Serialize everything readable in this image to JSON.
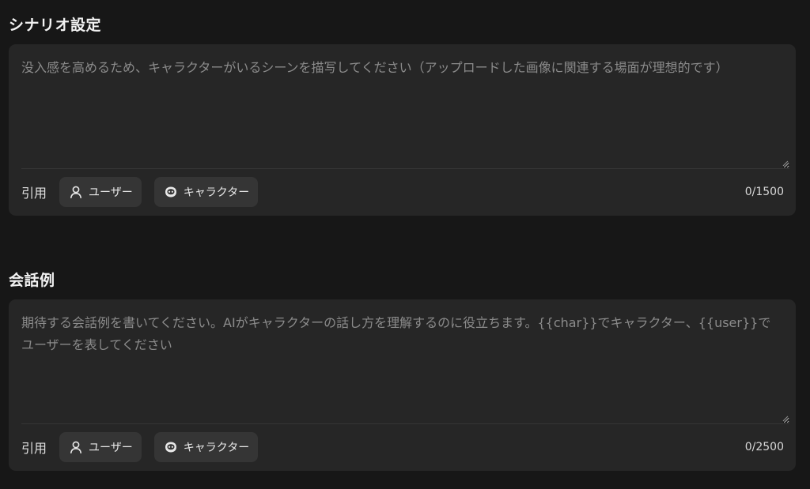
{
  "scenario": {
    "title": "シナリオ設定",
    "placeholder": "没入感を高めるため、キャラクターがいるシーンを描写してください（アップロードした画像に関連する場面が理想的です）",
    "value": "",
    "cite_label": "引用",
    "user_chip": "ユーザー",
    "character_chip": "キャラクター",
    "counter": "0/1500"
  },
  "dialogue": {
    "title": "会話例",
    "placeholder": "期待する会話例を書いてください。AIがキャラクターの話し方を理解するのに役立ちます。{{char}}でキャラクター、{{user}}でユーザーを表してください",
    "value": "",
    "cite_label": "引用",
    "user_chip": "ユーザー",
    "character_chip": "キャラクター",
    "counter": "0/2500"
  },
  "icons": {
    "user": "user-icon",
    "character": "character-face-icon",
    "resize": "resize-grip-icon"
  },
  "colors": {
    "background": "#171717",
    "card": "#262626",
    "chip": "#353535",
    "placeholder": "#8b8b8b"
  }
}
